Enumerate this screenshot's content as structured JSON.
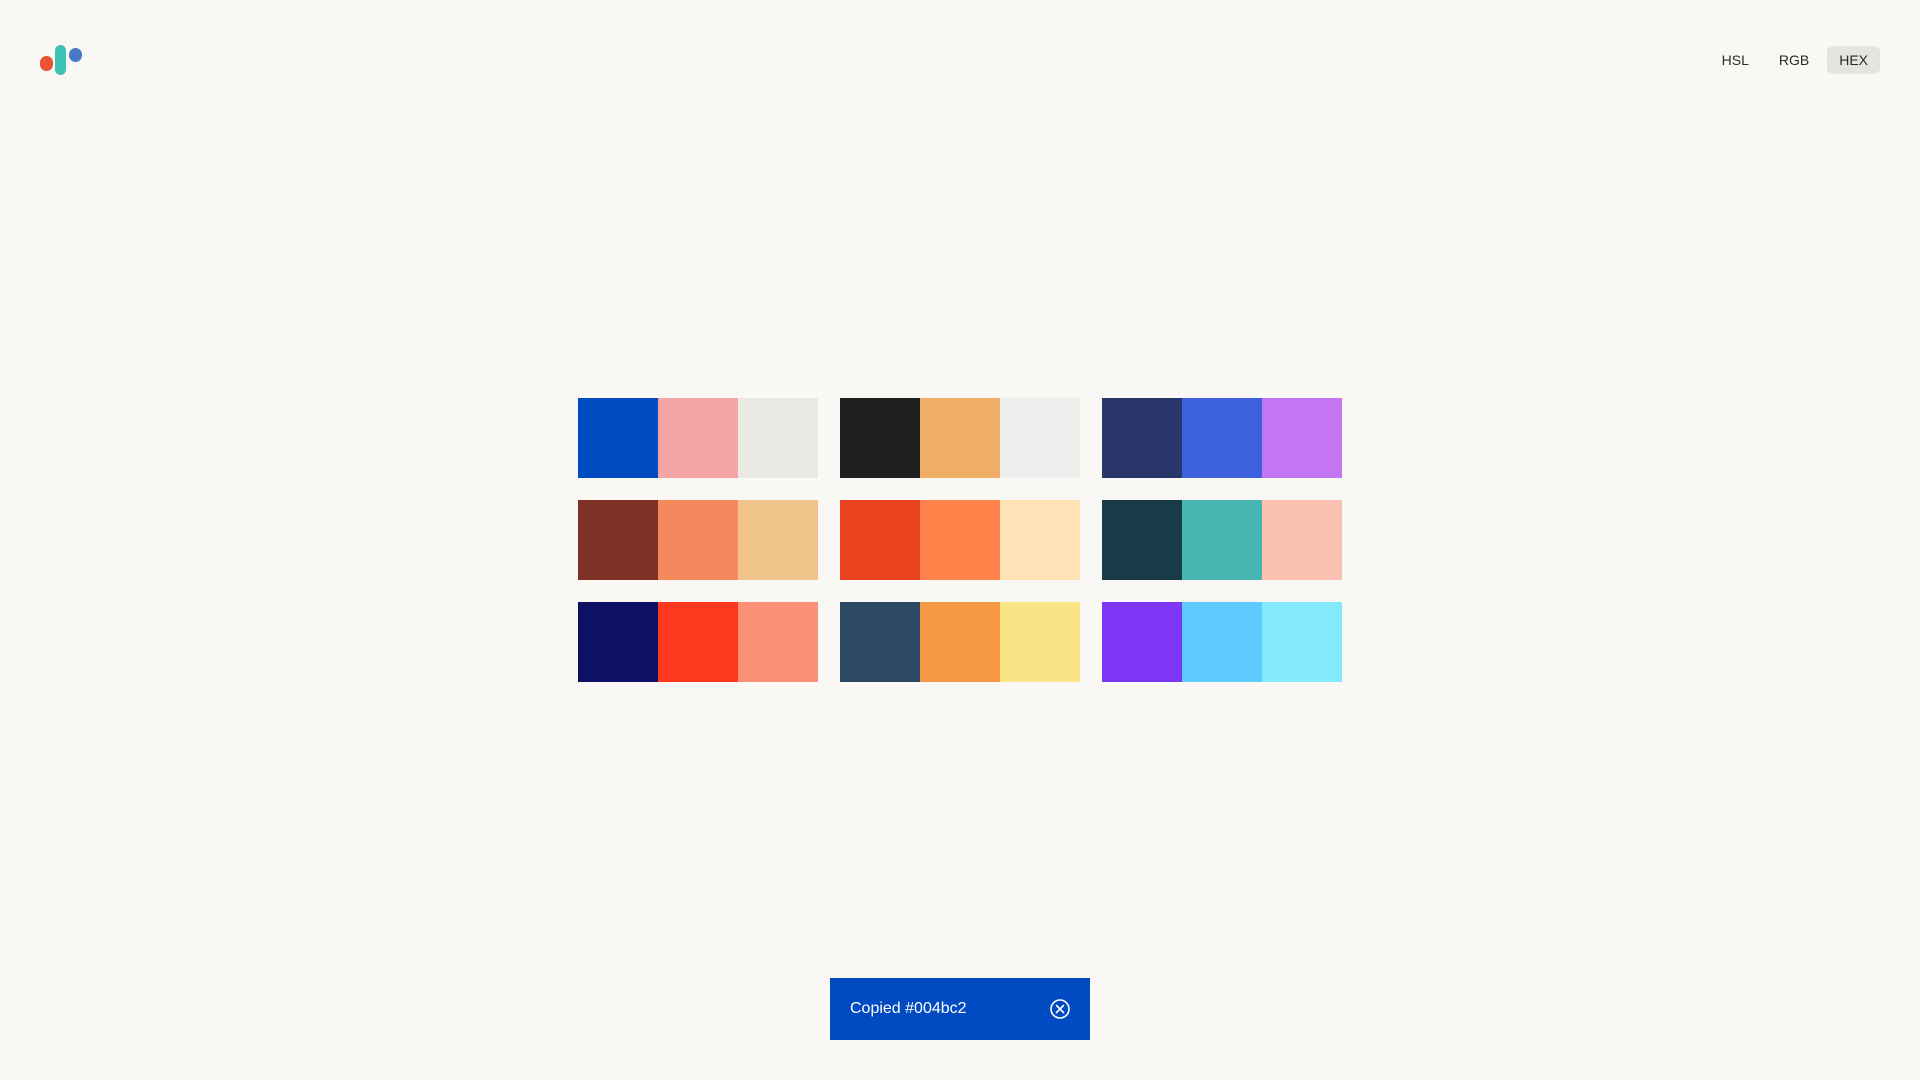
{
  "logo": {
    "colors": [
      "#e9532f",
      "#3ec2b3",
      "#4a79c9"
    ]
  },
  "format_toggle": {
    "options": [
      {
        "label": "HSL",
        "active": false
      },
      {
        "label": "RGB",
        "active": false
      },
      {
        "label": "HEX",
        "active": true
      }
    ]
  },
  "palettes": [
    {
      "colors": [
        "#004bc2",
        "#f4a4a6",
        "#ebe9e4"
      ]
    },
    {
      "colors": [
        "#1f1f1f",
        "#f0ad66",
        "#eff0ee"
      ]
    },
    {
      "colors": [
        "#29366b",
        "#3d60dc",
        "#c375f2"
      ]
    },
    {
      "colors": [
        "#803126",
        "#f4895e",
        "#efc38a"
      ]
    },
    {
      "colors": [
        "#e9421f",
        "#ff824b",
        "#ffe2b5"
      ]
    },
    {
      "colors": [
        "#173c47",
        "#47b6b3",
        "#fbc2b1"
      ]
    },
    {
      "colors": [
        "#0e1066",
        "#fc391f",
        "#fc9177"
      ]
    },
    {
      "colors": [
        "#2c4966",
        "#f69944",
        "#f9e486"
      ]
    },
    {
      "colors": [
        "#7e36f5",
        "#5ecafd",
        "#83e9fc"
      ]
    }
  ],
  "toast": {
    "message": "Copied #004bc2",
    "background": "#004bc2",
    "close_icon": "close-circle-icon"
  }
}
